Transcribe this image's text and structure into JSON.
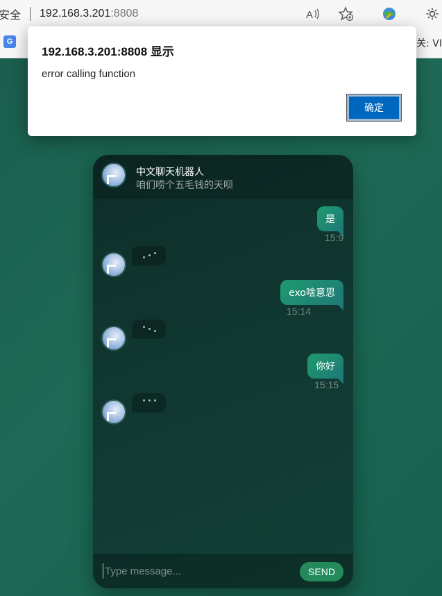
{
  "browser": {
    "security_label": "安全",
    "url_host": "192.168.3.201",
    "url_port": ":8808",
    "fav_left_label": "G",
    "fav_right_text": "关: VI"
  },
  "dialog": {
    "title": "192.168.3.201:8808 显示",
    "message": "error calling function",
    "ok_label": "确定"
  },
  "chat": {
    "title": "中文聊天机器人",
    "subtitle": "咱们唠个五毛钱的天呗",
    "messages": [
      {
        "from": "user",
        "text": "是",
        "time": "15:9"
      },
      {
        "from": "bot",
        "typing": true
      },
      {
        "from": "user",
        "text": "exo啥意思",
        "time": "15:14"
      },
      {
        "from": "bot",
        "typing": true
      },
      {
        "from": "user",
        "text": "你好",
        "time": "15:15"
      },
      {
        "from": "bot",
        "typing": true
      }
    ],
    "input_placeholder": "Type message...",
    "send_label": "SEND"
  },
  "colors": {
    "page_background": "#1d6654",
    "user_bubble": "#1f9a6e",
    "send_button": "#248a5c",
    "dialog_ok": "#0067c0"
  }
}
